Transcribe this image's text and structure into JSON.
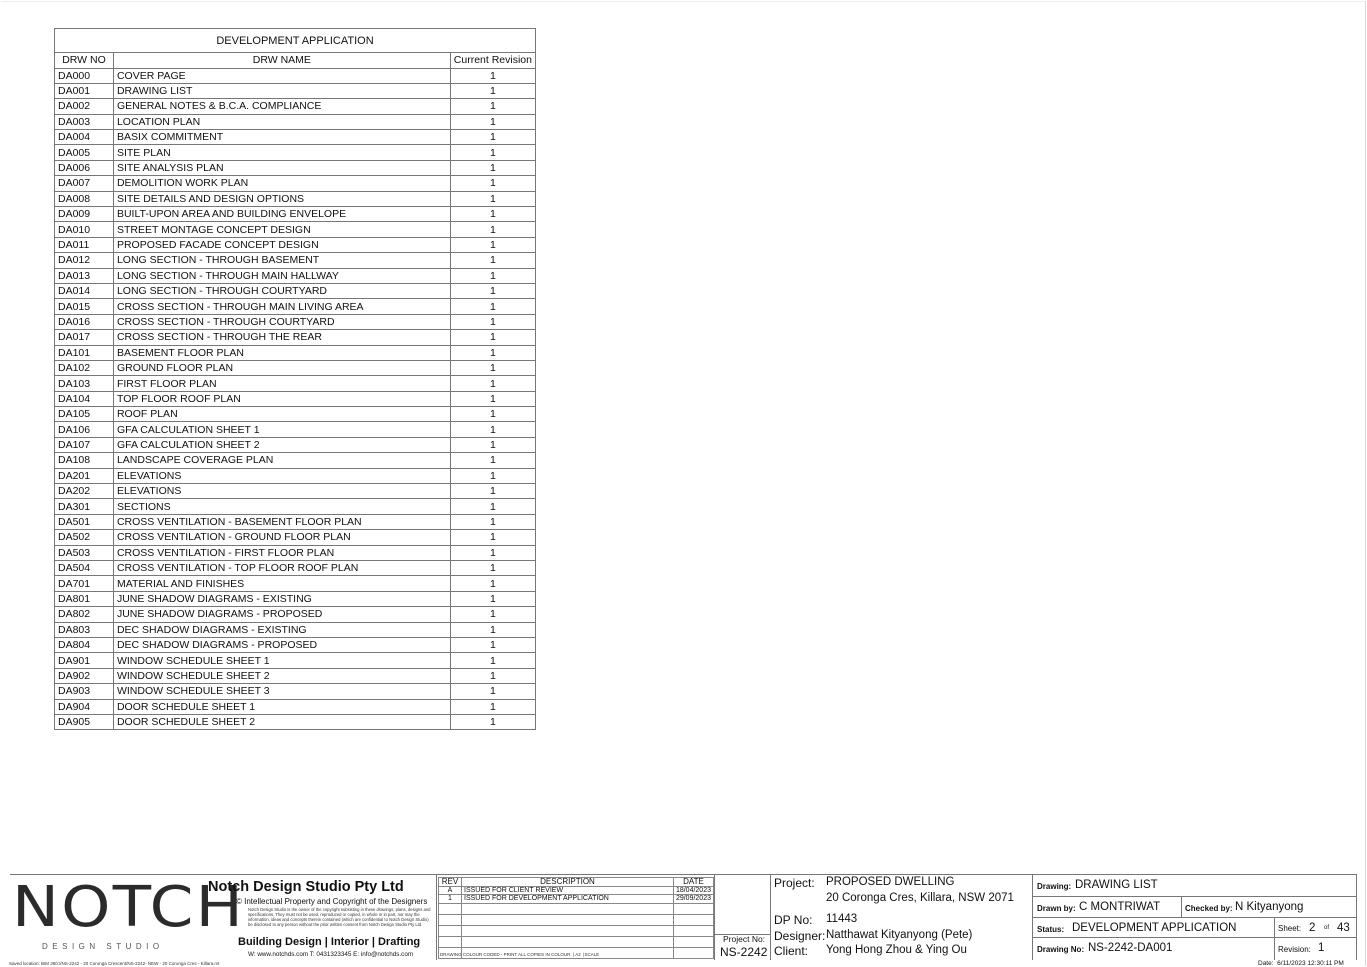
{
  "table": {
    "title": "DEVELOPMENT APPLICATION",
    "headers": [
      "DRW NO",
      "DRW NAME",
      "Current Revision"
    ],
    "rows": [
      [
        "DA000",
        "COVER PAGE",
        "1"
      ],
      [
        "DA001",
        "DRAWING LIST",
        "1"
      ],
      [
        "DA002",
        "GENERAL NOTES & B.C.A. COMPLIANCE",
        "1"
      ],
      [
        "DA003",
        "LOCATION PLAN",
        "1"
      ],
      [
        "DA004",
        "BASIX COMMITMENT",
        "1"
      ],
      [
        "DA005",
        "SITE PLAN",
        "1"
      ],
      [
        "DA006",
        "SITE ANALYSIS PLAN",
        "1"
      ],
      [
        "DA007",
        "DEMOLITION WORK PLAN",
        "1"
      ],
      [
        "DA008",
        "SITE DETAILS AND DESIGN OPTIONS",
        "1"
      ],
      [
        "DA009",
        "BUILT-UPON AREA AND BUILDING ENVELOPE",
        "1"
      ],
      [
        "DA010",
        "STREET MONTAGE CONCEPT DESIGN",
        "1"
      ],
      [
        "DA011",
        "PROPOSED FACADE CONCEPT DESIGN",
        "1"
      ],
      [
        "DA012",
        "LONG SECTION - THROUGH BASEMENT",
        "1"
      ],
      [
        "DA013",
        "LONG SECTION - THROUGH MAIN HALLWAY",
        "1"
      ],
      [
        "DA014",
        "LONG SECTION - THROUGH COURTYARD",
        "1"
      ],
      [
        "DA015",
        "CROSS SECTION - THROUGH MAIN LIVING AREA",
        "1"
      ],
      [
        "DA016",
        "CROSS SECTION - THROUGH COURTYARD",
        "1"
      ],
      [
        "DA017",
        "CROSS SECTION - THROUGH THE REAR",
        "1"
      ],
      [
        "DA101",
        "BASEMENT FLOOR PLAN",
        "1"
      ],
      [
        "DA102",
        "GROUND FLOOR PLAN",
        "1"
      ],
      [
        "DA103",
        "FIRST FLOOR PLAN",
        "1"
      ],
      [
        "DA104",
        "TOP FLOOR ROOF PLAN",
        "1"
      ],
      [
        "DA105",
        "ROOF PLAN",
        "1"
      ],
      [
        "DA106",
        "GFA CALCULATION SHEET 1",
        "1"
      ],
      [
        "DA107",
        "GFA CALCULATION SHEET 2",
        "1"
      ],
      [
        "DA108",
        "LANDSCAPE COVERAGE PLAN",
        "1"
      ],
      [
        "DA201",
        "ELEVATIONS",
        "1"
      ],
      [
        "DA202",
        "ELEVATIONS",
        "1"
      ],
      [
        "DA301",
        "SECTIONS",
        "1"
      ],
      [
        "DA501",
        "CROSS VENTILATION - BASEMENT FLOOR PLAN",
        "1"
      ],
      [
        "DA502",
        "CROSS VENTILATION - GROUND FLOOR PLAN",
        "1"
      ],
      [
        "DA503",
        "CROSS VENTILATION - FIRST FLOOR PLAN",
        "1"
      ],
      [
        "DA504",
        "CROSS VENTILATION - TOP FLOOR  ROOF PLAN",
        "1"
      ],
      [
        "DA701",
        "MATERIAL AND FINISHES",
        "1"
      ],
      [
        "DA801",
        "JUNE SHADOW DIAGRAMS - EXISTING",
        "1"
      ],
      [
        "DA802",
        "JUNE SHADOW DIAGRAMS - PROPOSED",
        "1"
      ],
      [
        "DA803",
        "DEC SHADOW DIAGRAMS - EXISTING",
        "1"
      ],
      [
        "DA804",
        "DEC SHADOW DIAGRAMS - PROPOSED",
        "1"
      ],
      [
        "DA901",
        "WINDOW SCHEDULE SHEET 1",
        "1"
      ],
      [
        "DA902",
        "WINDOW SCHEDULE SHEET 2",
        "1"
      ],
      [
        "DA903",
        "WINDOW SCHEDULE SHEET 3",
        "1"
      ],
      [
        "DA904",
        "DOOR SCHEDULE SHEET 1",
        "1"
      ],
      [
        "DA905",
        "DOOR SCHEDULE SHEET 2",
        "1"
      ]
    ]
  },
  "title_block": {
    "logo_text": "NOTCH",
    "logo_subtext": "DESIGN STUDIO",
    "company": "Notch Design Studio Pty Ltd",
    "copyright": "© Intellectual Property and Copyright of the Designers",
    "disclaimer": "Notch Design Studio is the owner of the copyright subsisting in these drawings, plans, designs and specifications. They must not be used, reproduced or copied, in whole or in part, nor may the information, ideas and concepts therein contained (which are confidential to Notch Design Studio) be disclosed to any person without the prior written consent from Notch Design Studio Pty Ltd.",
    "services": "Building Design | Interior | Drafting",
    "contact": "W: www.notchds.com  T: 0431323345  E: info@notchds.com",
    "revisions": {
      "headers": [
        "REV",
        "DESCRIPTION",
        "DATE"
      ],
      "rows": [
        [
          "A",
          "ISSUED FOR CLIENT REVIEW",
          "18/04/2023"
        ],
        [
          "1",
          "ISSUED FOR DEVELOPMENT APPLICATION",
          "29/09/2023"
        ]
      ],
      "footer_note": "DRAWING COLOUR CODED - PRINT ALL COPIES IN COLOUR",
      "paper_size": "A2",
      "scale_label": "SCALE"
    },
    "project_no_label": "Project No:",
    "project_no": "NS-2242",
    "project_label": "Project:",
    "project": "PROPOSED DWELLING",
    "address": "20 Coronga Cres, Killara, NSW 2071",
    "dp_label": "DP No:",
    "dp": "11443",
    "designer_label": "Designer:",
    "designer": "Natthawat Kityanyong (Pete)",
    "client_label": "Client:",
    "client": "Yong Hong Zhou & Ying Ou",
    "drawing_label": "Drawing:",
    "drawing": "DRAWING LIST",
    "drawn_by_label": "Drawn by:",
    "drawn_by": "C MONTRIWAT",
    "checked_by_label": "Checked by:",
    "checked_by": "N Kityanyong",
    "status_label": "Status:",
    "status": "DEVELOPMENT APPLICATION",
    "sheet_label": "Sheet:",
    "sheet": "2",
    "sheet_of": "of",
    "sheet_total": "43",
    "drawing_no_label": "Drawing No:",
    "drawing_no": "NS-2242-DA001",
    "revision_label": "Revision:",
    "revision": "1"
  },
  "footer": {
    "saved_location": "Saved location:  BIM 360://NS-2242 - 20 Coronga Crescent/NS-2242- NEW - 20 Coronga Cres - Killara.rvt",
    "date_label": "Date:",
    "date": "6/11/2023 12:30:11 PM"
  }
}
